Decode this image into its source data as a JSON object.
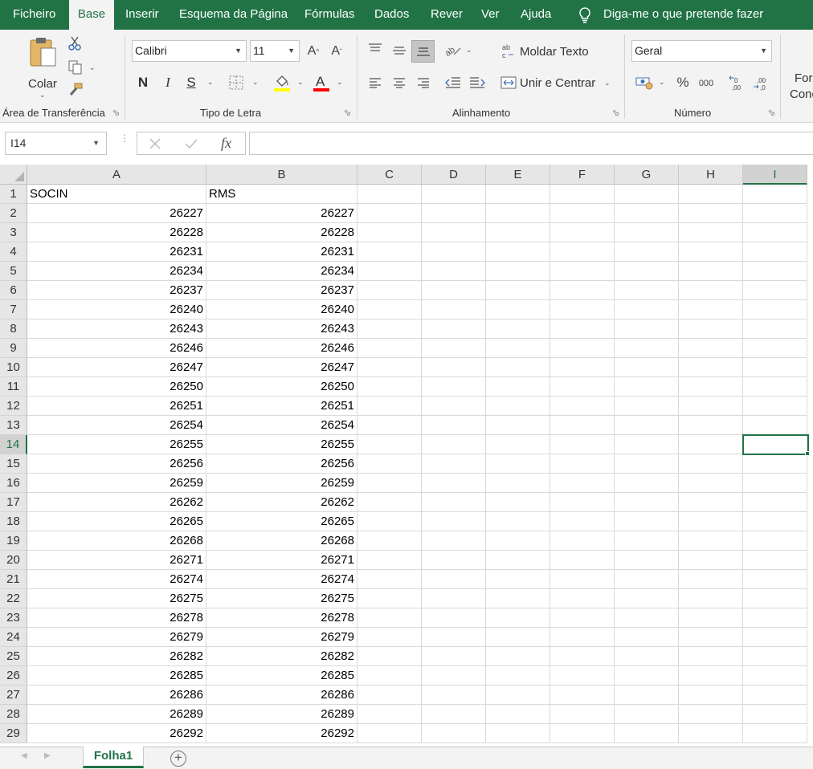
{
  "menu": {
    "tabs": [
      "Ficheiro",
      "Base",
      "Inserir",
      "Esquema da Página",
      "Fórmulas",
      "Dados",
      "Rever",
      "Ver",
      "Ajuda"
    ],
    "active_tab": "Base",
    "tell_me": "Diga-me o que pretende fazer"
  },
  "ribbon": {
    "clipboard": {
      "paste_label": "Colar",
      "group_label": "Área de Transferência"
    },
    "font": {
      "font_name": "Calibri",
      "font_size": "11",
      "bold_label": "N",
      "italic_label": "I",
      "underline_label": "S",
      "group_label": "Tipo de Letra",
      "highlight_color": "#ffff00",
      "font_color": "#ff0000"
    },
    "alignment": {
      "wrap_text": "Moldar Texto",
      "merge_center": "Unir e Centrar",
      "group_label": "Alinhamento"
    },
    "number": {
      "format": "Geral",
      "percent": "%",
      "thousands": "000",
      "group_label": "Número"
    },
    "styles_partial": {
      "line1": "For",
      "line2": "Conc"
    }
  },
  "formula_bar": {
    "name_box": "I14",
    "fx_label": "fx",
    "content": ""
  },
  "grid": {
    "columns": [
      "A",
      "B",
      "C",
      "D",
      "E",
      "F",
      "G",
      "H",
      "I"
    ],
    "selected_column": "I",
    "selected_row": "14",
    "rows": [
      {
        "n": "1",
        "a": "SOCIN",
        "b": "RMS"
      },
      {
        "n": "2",
        "a": "26227",
        "b": "26227"
      },
      {
        "n": "3",
        "a": "26228",
        "b": "26228"
      },
      {
        "n": "4",
        "a": "26231",
        "b": "26231"
      },
      {
        "n": "5",
        "a": "26234",
        "b": "26234"
      },
      {
        "n": "6",
        "a": "26237",
        "b": "26237"
      },
      {
        "n": "7",
        "a": "26240",
        "b": "26240"
      },
      {
        "n": "8",
        "a": "26243",
        "b": "26243"
      },
      {
        "n": "9",
        "a": "26246",
        "b": "26246"
      },
      {
        "n": "10",
        "a": "26247",
        "b": "26247"
      },
      {
        "n": "11",
        "a": "26250",
        "b": "26250"
      },
      {
        "n": "12",
        "a": "26251",
        "b": "26251"
      },
      {
        "n": "13",
        "a": "26254",
        "b": "26254"
      },
      {
        "n": "14",
        "a": "26255",
        "b": "26255"
      },
      {
        "n": "15",
        "a": "26256",
        "b": "26256"
      },
      {
        "n": "16",
        "a": "26259",
        "b": "26259"
      },
      {
        "n": "17",
        "a": "26262",
        "b": "26262"
      },
      {
        "n": "18",
        "a": "26265",
        "b": "26265"
      },
      {
        "n": "19",
        "a": "26268",
        "b": "26268"
      },
      {
        "n": "20",
        "a": "26271",
        "b": "26271"
      },
      {
        "n": "21",
        "a": "26274",
        "b": "26274"
      },
      {
        "n": "22",
        "a": "26275",
        "b": "26275"
      },
      {
        "n": "23",
        "a": "26278",
        "b": "26278"
      },
      {
        "n": "24",
        "a": "26279",
        "b": "26279"
      },
      {
        "n": "25",
        "a": "26282",
        "b": "26282"
      },
      {
        "n": "26",
        "a": "26285",
        "b": "26285"
      },
      {
        "n": "27",
        "a": "26286",
        "b": "26286"
      },
      {
        "n": "28",
        "a": "26289",
        "b": "26289"
      },
      {
        "n": "29",
        "a": "26292",
        "b": "26292"
      }
    ]
  },
  "sheets": {
    "active": "Folha1"
  },
  "colors": {
    "accent": "#217346"
  }
}
